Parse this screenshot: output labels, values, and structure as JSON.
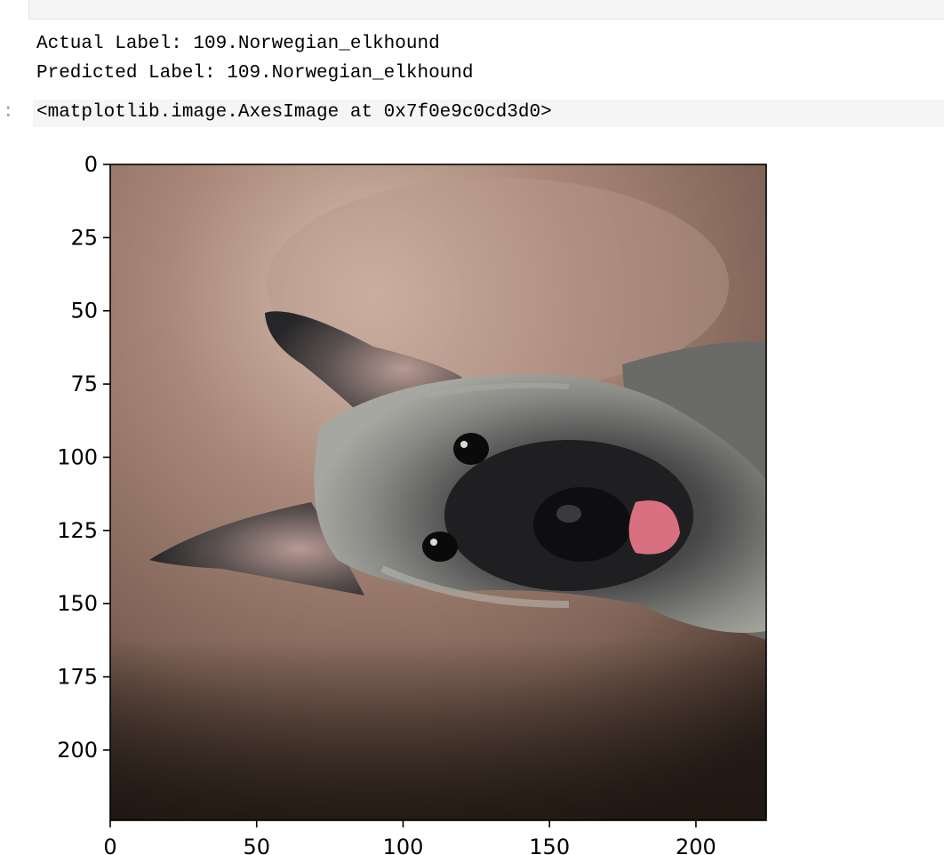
{
  "stdout": {
    "actual": "Actual Label: 109.Norwegian_elkhound",
    "predicted": "Predicted Label: 109.Norwegian_elkhound"
  },
  "output": {
    "prompt": ":",
    "repr": "<matplotlib.image.AxesImage at 0x7f0e9c0cd3d0>"
  },
  "chart_data": {
    "type": "image",
    "x_ticks": [
      0,
      50,
      100,
      150,
      200
    ],
    "y_ticks": [
      0,
      25,
      50,
      75,
      100,
      125,
      150,
      175,
      200
    ],
    "xlim": [
      0,
      224
    ],
    "ylim": [
      224,
      0
    ],
    "x_tick_labels": [
      "0",
      "50",
      "100",
      "150",
      "200"
    ],
    "y_tick_labels": [
      "0",
      "25",
      "50",
      "75",
      "100",
      "125",
      "150",
      "175",
      "200"
    ],
    "image_subject": "dog-head-rotated"
  },
  "colors": {
    "background_brown": "#9b7c6e",
    "fur_dark": "#1e1e20",
    "fur_grey": "#7a7a78",
    "tongue": "#d9707f"
  }
}
